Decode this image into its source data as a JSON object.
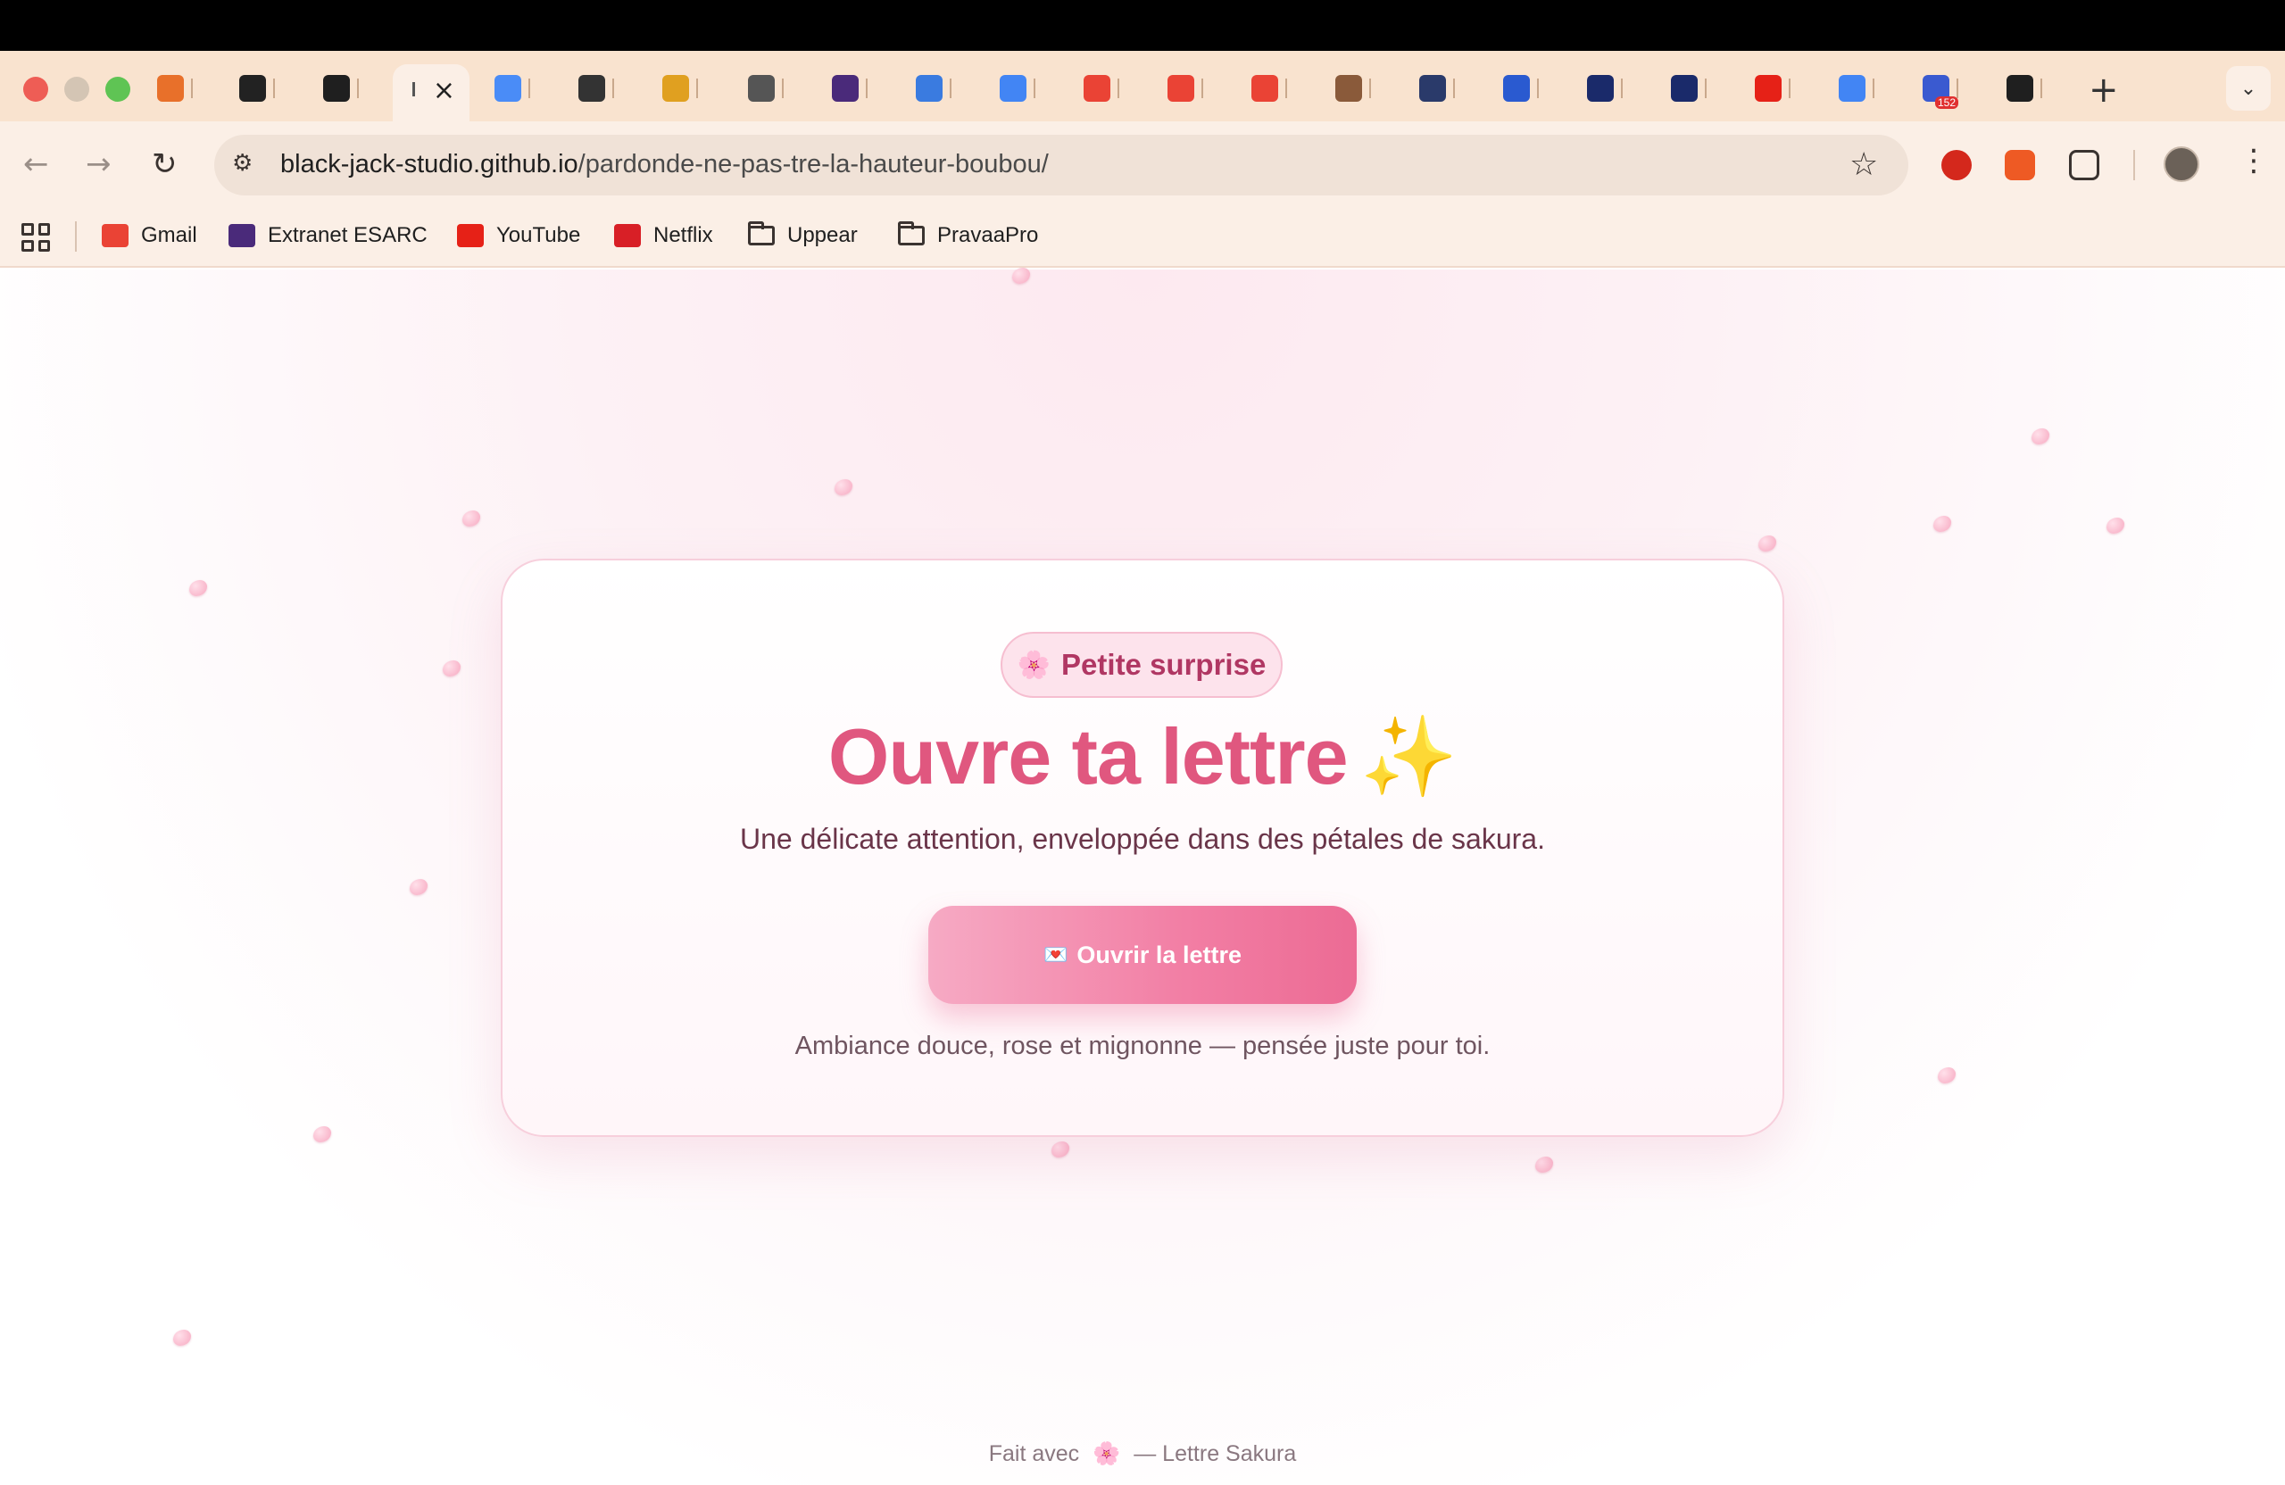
{
  "browser": {
    "active_tab_close": "×",
    "new_tab": "+",
    "tab_dropdown": "⌄",
    "url_host": "black-jack-studio.github.io",
    "url_path": "/pardonde-ne-pas-tre-la-hauteur-boubou/",
    "tabs": [
      {
        "icon": "orange-puzzle-icon",
        "color": "#e8702a"
      },
      {
        "icon": "green-bolt-icon",
        "color": "#222222"
      },
      {
        "icon": "github-icon",
        "color": "#1f1f1f"
      },
      {
        "icon": "blue-apple-icon",
        "color": "#4a8cf7"
      },
      {
        "icon": "apple-icon",
        "color": "#333333"
      },
      {
        "icon": "circle-logo-icon",
        "color": "#e0a020"
      },
      {
        "icon": "stencil-icon",
        "color": "#555555"
      },
      {
        "icon": "purple-square-icon",
        "color": "#4a2a7a"
      },
      {
        "icon": "contacts-icon",
        "color": "#3a7be0"
      },
      {
        "icon": "google-icon",
        "color": "#4285f4"
      },
      {
        "icon": "gmail-icon",
        "color": "#ea4335"
      },
      {
        "icon": "gmail-icon",
        "color": "#ea4335"
      },
      {
        "icon": "gmail-icon",
        "color": "#ea4335"
      },
      {
        "icon": "figure-icon",
        "color": "#8a5a3a"
      },
      {
        "icon": "banner-icon",
        "color": "#2a3a6a"
      },
      {
        "icon": "shield-icon",
        "color": "#2a5ad0"
      },
      {
        "icon": "p-logo-icon",
        "color": "#1a2a6a"
      },
      {
        "icon": "p-logo-icon",
        "color": "#1a2a6a"
      },
      {
        "icon": "youtube-icon",
        "color": "#e62117"
      },
      {
        "icon": "google-icon",
        "color": "#4285f4"
      },
      {
        "icon": "calendar-badge-icon",
        "color": "#3a5ad0",
        "badge": "152"
      },
      {
        "icon": "github-icon",
        "color": "#1f1f1f"
      }
    ]
  },
  "bookmarks": [
    {
      "label": "Gmail",
      "icon": "gmail-icon",
      "color": "#ea4335"
    },
    {
      "label": "Extranet ESARC",
      "icon": "esarc-icon",
      "color": "#4a2a7a"
    },
    {
      "label": "YouTube",
      "icon": "youtube-icon",
      "color": "#e62117"
    },
    {
      "label": "Netflix",
      "icon": "netflix-icon",
      "color": "#d81f26"
    },
    {
      "label": "Uppear",
      "icon": "folder-icon",
      "color": "#3a3330"
    },
    {
      "label": "PravaaPro",
      "icon": "folder-icon",
      "color": "#3a3330"
    }
  ],
  "page": {
    "pill_emoji": "🌸",
    "pill_text": "Petite surprise",
    "headline": "Ouvre ta lettre",
    "headline_sparkle": "✨",
    "subtitle": "Une délicate attention, enveloppée dans des pétales de sakura.",
    "button_emoji": "💌",
    "button_label": "Ouvrir la lettre",
    "ambiance": "Ambiance douce, rose et mignonne — pensée juste pour toi.",
    "footer_prefix": "Fait avec",
    "footer_emoji": "🌸",
    "footer_sep": "—",
    "footer_suffix": "Lettre Sakura"
  },
  "colors": {
    "accent": "#e0577f",
    "button_start": "#f6aac4",
    "button_end": "#ec6b94",
    "tabstrip": "#f9e3cf",
    "toolbar": "#fbefe6"
  }
}
